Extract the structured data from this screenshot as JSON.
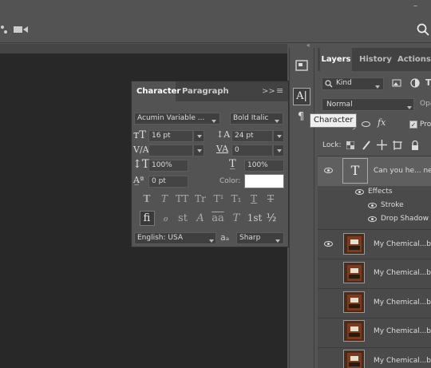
{
  "top_bar": {
    "minimize": "–"
  },
  "options_bar": {
    "search_icon": "search-icon"
  },
  "character_panel": {
    "tabs": [
      "Character",
      "Paragraph"
    ],
    "menu_collapse": ">>",
    "menu_icon": "≡",
    "font_family": "Acumin Variable ...",
    "font_style": "Bold Italic",
    "font_size": "16 pt",
    "leading": "24 pt",
    "kerning": "",
    "tracking": "0",
    "vertical_scale": "100%",
    "horizontal_scale": "100%",
    "baseline_shift": "0 pt",
    "color_label": "Color:",
    "color_value": "#ffffff",
    "style_glyphs": [
      "T",
      "T",
      "TT",
      "Tr",
      "T¹",
      "T₁",
      "T",
      "T"
    ],
    "opentype_glyphs": [
      "fi",
      "ℴ",
      "st",
      "A",
      "aa",
      "T",
      "1st",
      "½"
    ],
    "language": "English: USA",
    "aa_icon": "aₐ",
    "antialias": "Sharp"
  },
  "tooltip": "Character",
  "layers_panel": {
    "tabs": [
      "Layers",
      "History",
      "Actions"
    ],
    "filter": "Kind",
    "blend_mode": "Normal",
    "opacity_label": "Opa",
    "propagate_label": "Prop",
    "lock_label": "Lock:",
    "layers": [
      {
        "name": "Can you he... nea",
        "type": "text",
        "visible": true,
        "selected": true
      },
      {
        "name": "Effects",
        "type": "effects-header",
        "visible": true
      },
      {
        "name": "Stroke",
        "type": "effect",
        "visible": true
      },
      {
        "name": "Drop Shadow",
        "type": "effect",
        "visible": true
      },
      {
        "name": "My Chemical...bm",
        "type": "image",
        "visible": true
      },
      {
        "name": "My Chemical...bm",
        "type": "image",
        "visible": false
      },
      {
        "name": "My Chemical...bm",
        "type": "image",
        "visible": false
      },
      {
        "name": "My Chemical...bm",
        "type": "image",
        "visible": false
      },
      {
        "name": "My Chemical...bm",
        "type": "image",
        "visible": false
      }
    ]
  }
}
